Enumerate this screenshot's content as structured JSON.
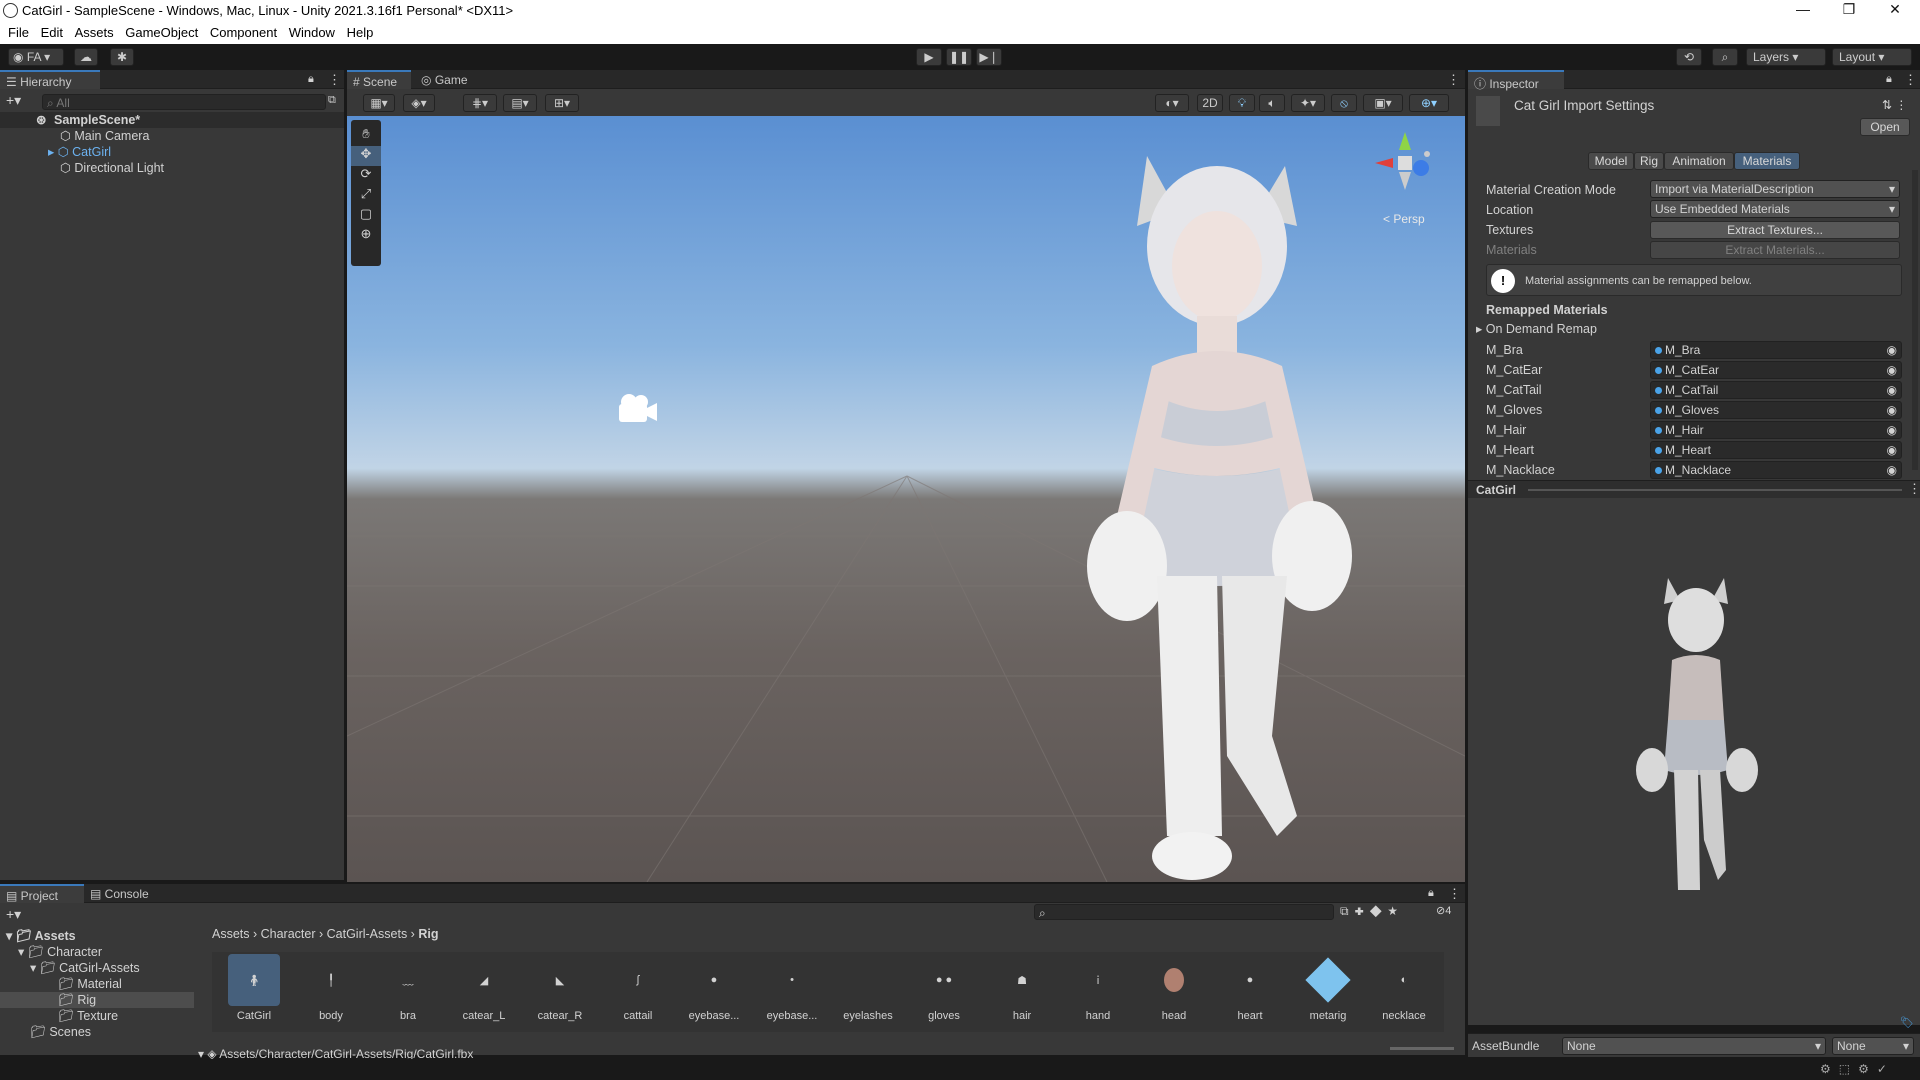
{
  "window": {
    "title": "CatGirl - SampleScene - Windows, Mac, Linux - Unity 2021.3.16f1 Personal* <DX11>"
  },
  "menu": [
    "File",
    "Edit",
    "Assets",
    "GameObject",
    "Component",
    "Window",
    "Help"
  ],
  "toolbar": {
    "account": "FA",
    "layers": "Layers",
    "layout": "Layout"
  },
  "hierarchy": {
    "tab": "Hierarchy",
    "search_placeholder": "All",
    "scene": "SampleScene*",
    "items": [
      "Main Camera",
      "CatGirl",
      "Directional Light"
    ]
  },
  "scene_tabs": {
    "scene": "Scene",
    "game": "Game"
  },
  "scene_view": {
    "toggle_2d": "2D",
    "persp": "Persp"
  },
  "inspector": {
    "tab": "Inspector",
    "title": "Cat Girl Import Settings",
    "open_button": "Open",
    "subtabs": [
      "Model",
      "Rig",
      "Animation",
      "Materials"
    ],
    "active_subtab": "Materials",
    "material_creation_mode_label": "Material Creation Mode",
    "material_creation_mode_value": "Import via MaterialDescription",
    "location_label": "Location",
    "location_value": "Use Embedded Materials",
    "textures_label": "Textures",
    "extract_textures": "Extract Textures...",
    "materials_label": "Materials",
    "extract_materials": "Extract Materials...",
    "info": "Material assignments can be remapped below.",
    "remapped_header": "Remapped Materials",
    "on_demand": "On Demand Remap",
    "remaps": [
      {
        "name": "M_Bra",
        "value": "M_Bra"
      },
      {
        "name": "M_CatEar",
        "value": "M_CatEar"
      },
      {
        "name": "M_CatTail",
        "value": "M_CatTail"
      },
      {
        "name": "M_Gloves",
        "value": "M_Gloves"
      },
      {
        "name": "M_Hair",
        "value": "M_Hair"
      },
      {
        "name": "M_Heart",
        "value": "M_Heart"
      },
      {
        "name": "M_Nacklace",
        "value": "M_Nacklace"
      }
    ],
    "preview_title": "CatGirl",
    "assetbundle_label": "AssetBundle",
    "assetbundle_value": "None",
    "assetbundle_variant": "None"
  },
  "project": {
    "tabs": [
      "Project",
      "Console"
    ],
    "hidden_count": "4",
    "tree": [
      "Assets",
      "Character",
      "CatGirl-Assets",
      "Material",
      "Rig",
      "Texture",
      "Scenes"
    ],
    "breadcrumb": [
      "Assets",
      "Character",
      "CatGirl-Assets",
      "Rig"
    ],
    "assets": [
      "CatGirl",
      "body",
      "bra",
      "catear_L",
      "catear_R",
      "cattail",
      "eyebase...",
      "eyebase...",
      "eyelashes",
      "gloves",
      "hair",
      "hand",
      "head",
      "heart",
      "metarig",
      "necklace"
    ],
    "path": "Assets/Character/CatGirl-Assets/Rig/CatGirl.fbx"
  },
  "colors": {
    "accent": "#3a79bb",
    "panel": "#383838",
    "dark": "#191919"
  }
}
